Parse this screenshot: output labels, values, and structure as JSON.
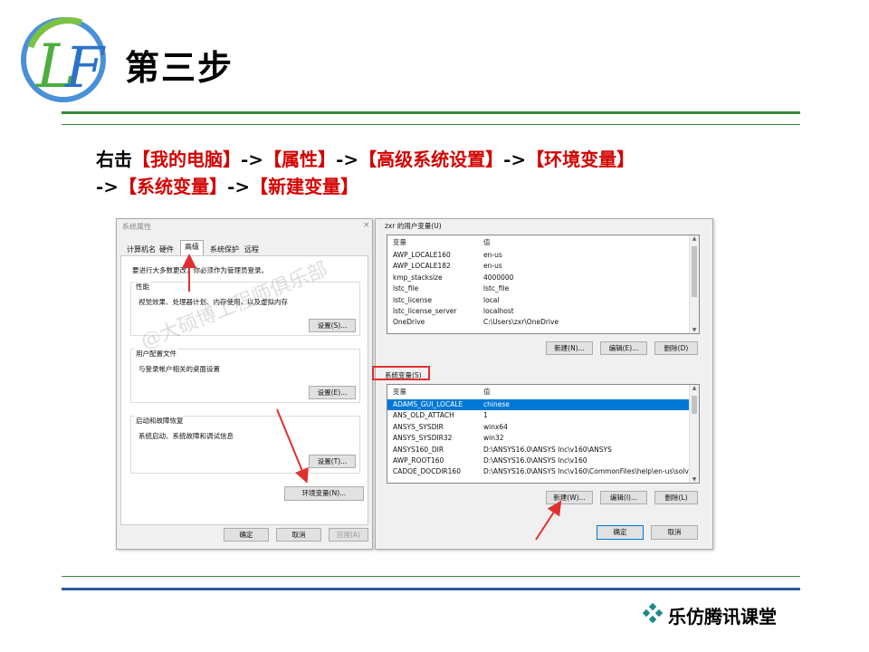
{
  "slide": {
    "title": "第三步",
    "instruction_line1": {
      "a": "右击",
      "b": "【我的电脑】",
      "c": "->",
      "d": "【属性】",
      "e": "->",
      "f": "【高级系统设置】",
      "g": "->",
      "h": "【环境变量】"
    },
    "instruction_line2": {
      "a": "->",
      "b": "【系统变量】",
      "c": "->",
      "d": "【新建变量】"
    },
    "footer_brand": "乐仿腾讯课堂",
    "watermark": "@大硕博工程师俱乐部"
  },
  "colors": {
    "accent_green": "#3a8a3a",
    "highlight_red": "#d40000",
    "selection_blue": "#0078d7"
  },
  "system_properties": {
    "title": "系统属性",
    "close": "×",
    "tabs": [
      "计算机名",
      "硬件",
      "高级",
      "系统保护",
      "远程"
    ],
    "selected_tab": "高级",
    "admin_note": "要进行大多数更改，你必须作为管理员登录。",
    "performance": {
      "label": "性能",
      "desc": "视觉效果、处理器计划、内存使用，以及虚拟内存",
      "button": "设置(S)..."
    },
    "user_profiles": {
      "label": "用户配置文件",
      "desc": "与登录帐户相关的桌面设置",
      "button": "设置(E)..."
    },
    "startup_recovery": {
      "label": "启动和故障恢复",
      "desc": "系统启动、系统故障和调试信息",
      "button": "设置(T)..."
    },
    "env_button": "环境变量(N)...",
    "ok": "确定",
    "cancel": "取消",
    "apply": "应用(A)"
  },
  "environment_variables": {
    "user_section_label": "zxr 的用户变量(U)",
    "columns": {
      "name": "变量",
      "value": "值"
    },
    "user_vars": [
      {
        "name": "AWP_LOCALE160",
        "value": "en-us"
      },
      {
        "name": "AWP_LOCALE182",
        "value": "en-us"
      },
      {
        "name": "kmp_stacksize",
        "value": "4000000"
      },
      {
        "name": "lstc_file",
        "value": "lstc_file"
      },
      {
        "name": "lstc_license",
        "value": "local"
      },
      {
        "name": "lstc_license_server",
        "value": "localhost"
      },
      {
        "name": "OneDrive",
        "value": "C:\\Users\\zxr\\OneDrive"
      }
    ],
    "user_buttons": {
      "new": "新建(N)...",
      "edit": "编辑(E)...",
      "delete": "删除(D)"
    },
    "system_section_label": "系统变量(S)",
    "system_vars": [
      {
        "name": "ADAMS_GUI_LOCALE",
        "value": "chinese",
        "selected": true
      },
      {
        "name": "ANS_OLD_ATTACH",
        "value": "1"
      },
      {
        "name": "ANSYS_SYSDIR",
        "value": "winx64"
      },
      {
        "name": "ANSYS_SYSDIR32",
        "value": "win32"
      },
      {
        "name": "ANSYS160_DIR",
        "value": "D:\\ANSYS16.0\\ANSYS Inc\\v160\\ANSYS"
      },
      {
        "name": "AWP_ROOT160",
        "value": "D:\\ANSYS16.0\\ANSYS Inc\\v160"
      },
      {
        "name": "CADOE_DOCDIR160",
        "value": "D:\\ANSYS16.0\\ANSYS Inc\\v160\\CommonFiles\\help\\en-us\\solv..."
      }
    ],
    "system_buttons": {
      "new": "新建(W)...",
      "edit": "编辑(I)...",
      "delete": "删除(L)"
    },
    "ok": "确定",
    "cancel": "取消"
  }
}
